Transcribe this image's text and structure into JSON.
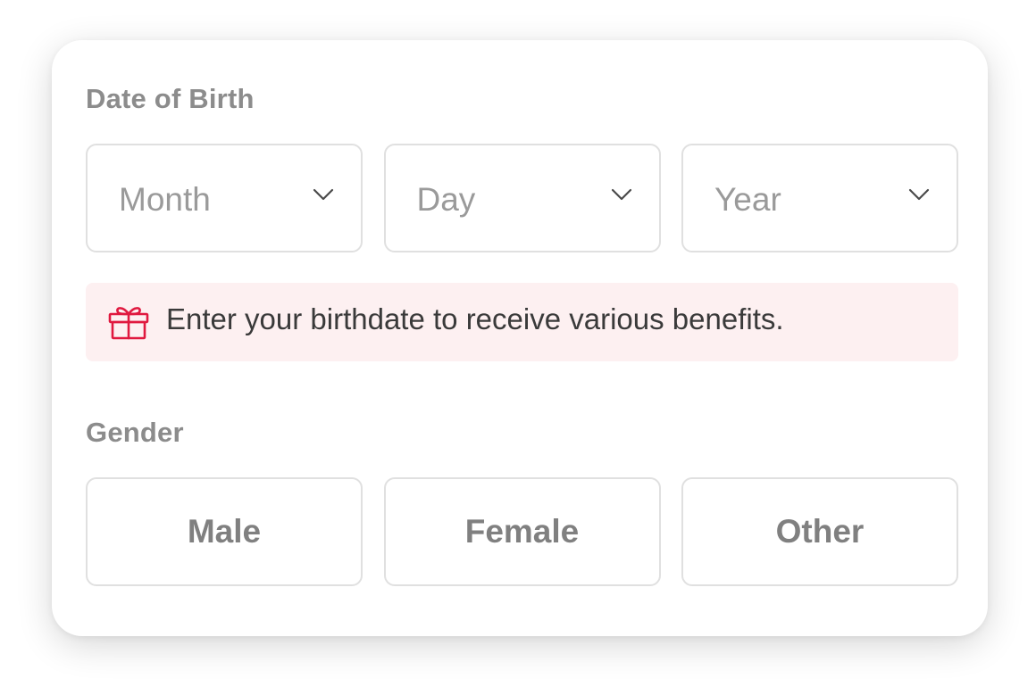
{
  "dob": {
    "label": "Date of Birth",
    "month_placeholder": "Month",
    "day_placeholder": "Day",
    "year_placeholder": "Year"
  },
  "notice": {
    "text": "Enter your birthdate to receive various benefits.",
    "icon": "gift-icon",
    "accent_color": "#e0193f",
    "background_color": "#fdf0f1"
  },
  "gender": {
    "label": "Gender",
    "options": [
      "Male",
      "Female",
      "Other"
    ]
  }
}
